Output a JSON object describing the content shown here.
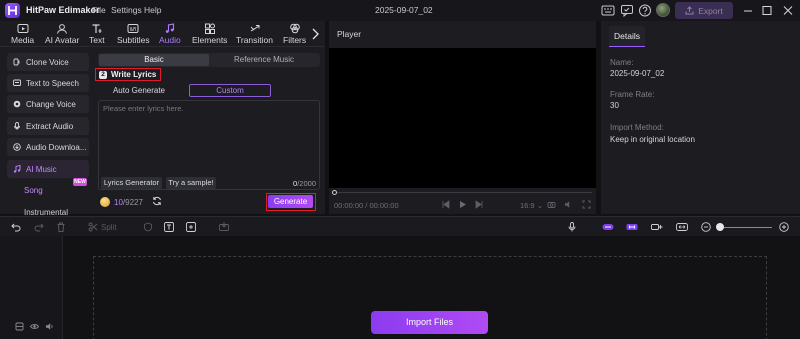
{
  "app": {
    "title": "HitPaw Edimakor",
    "menu": [
      "File",
      "Settings",
      "Help"
    ],
    "document_title": "2025-09-07_02",
    "export_label": "Export",
    "accent_color": "#9a5cff",
    "highlight_color": "#e11b2b"
  },
  "toolbar": {
    "items": [
      {
        "label": "Media",
        "icon": "media-icon"
      },
      {
        "label": "AI Avatar",
        "icon": "ai-avatar-icon"
      },
      {
        "label": "Text",
        "icon": "text-icon"
      },
      {
        "label": "Subtitles",
        "icon": "subtitles-icon"
      },
      {
        "label": "Audio",
        "icon": "audio-icon",
        "active": true
      },
      {
        "label": "Elements",
        "icon": "elements-icon"
      },
      {
        "label": "Transition",
        "icon": "transition-icon"
      },
      {
        "label": "Filters",
        "icon": "filters-icon"
      }
    ]
  },
  "audio_sidebar": {
    "items": [
      {
        "label": "Clone Voice",
        "icon": "clone-voice-icon"
      },
      {
        "label": "Text to Speech",
        "icon": "text-to-speech-icon"
      },
      {
        "label": "Change Voice",
        "icon": "change-voice-icon"
      },
      {
        "label": "Extract Audio",
        "icon": "extract-audio-icon"
      },
      {
        "label": "Audio Downloa...",
        "icon": "audio-download-icon"
      },
      {
        "label": "AI Music",
        "icon": "ai-music-icon",
        "active": true,
        "badge": "NEW"
      }
    ],
    "subitems": [
      "Song",
      "Instrumental"
    ]
  },
  "ai_music": {
    "tabs": [
      "Basic",
      "Reference Music"
    ],
    "active_tab": "Basic",
    "step_number": "2",
    "section_title": "Write Lyrics",
    "modes": [
      "Auto Generate",
      "Custom"
    ],
    "active_mode": "Custom",
    "lyrics_placeholder": "Please enter lyrics here.",
    "lyrics_generator_label": "Lyrics Generator",
    "sample_label": "Try a sample!",
    "char_count": "0",
    "char_max": "/2000",
    "credits_used": "10",
    "credits_total": "/9227",
    "generate_label": "Generate"
  },
  "player": {
    "title": "Player",
    "timecode_current": "00:00:00",
    "timecode_total": " / 00:00:00",
    "aspect_ratio": "16:9"
  },
  "details": {
    "tab": "Details",
    "name_label": "Name:",
    "name_value": "2025-09-07_02",
    "frame_rate_label": "Frame Rate:",
    "frame_rate_value": "30",
    "import_method_label": "Import Method:",
    "import_method_value": "Keep in original location"
  },
  "timeline": {
    "split_label": "Split",
    "import_label": "Import Files"
  }
}
